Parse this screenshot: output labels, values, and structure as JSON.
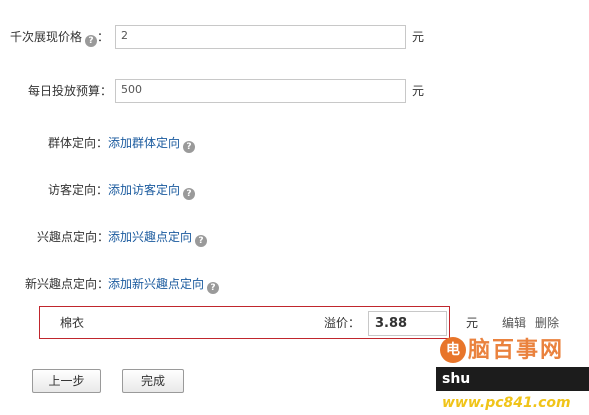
{
  "form": {
    "cpm_price": {
      "label": "千次展现价格",
      "value": "2",
      "unit": "元"
    },
    "daily_budget": {
      "label": "每日投放预算：",
      "value": "500",
      "unit": "元"
    },
    "group_targeting": {
      "label": "群体定向：",
      "link": "添加群体定向"
    },
    "visitor_targeting": {
      "label": "访客定向：",
      "link": "添加访客定向"
    },
    "interest_targeting": {
      "label": "兴趣点定向：",
      "link": "添加兴趣点定向"
    },
    "new_interest_targeting": {
      "label": "新兴趣点定向：",
      "link": "添加新兴趣点定向"
    },
    "help_symbol": "?"
  },
  "target_item": {
    "name": "棉衣",
    "premium_label": "溢价：",
    "premium_value": "3.88",
    "unit": "元",
    "edit_label": "编辑",
    "delete_label": "删除"
  },
  "buttons": {
    "prev": "上一步",
    "finish": "完成"
  },
  "watermark": {
    "badge": "电",
    "cn": "脑百事网",
    "en_left": "shu",
    "en_right": "www.pc841.com"
  }
}
